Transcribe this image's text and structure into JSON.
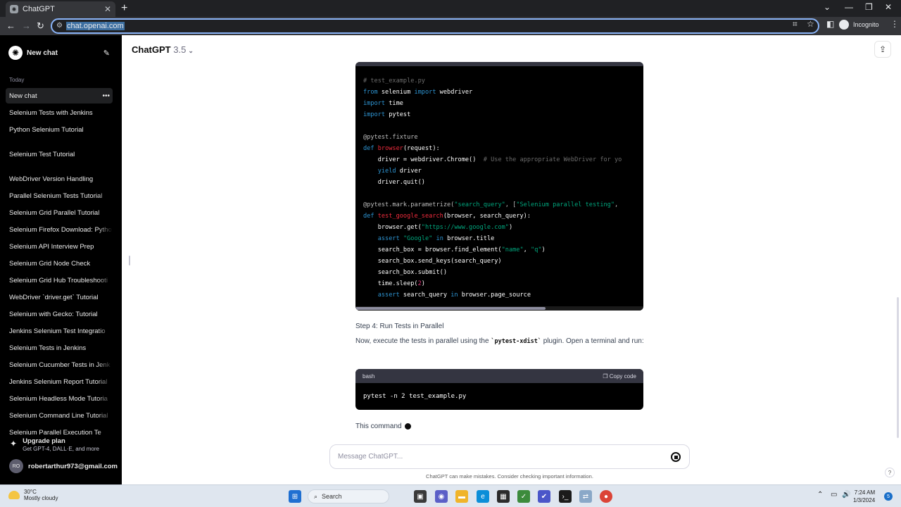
{
  "browser": {
    "tab_title": "ChatGPT",
    "tab_close": "✕",
    "new_tab": "+",
    "url": "chat.openai.com",
    "incognito_label": "Incognito"
  },
  "sidebar": {
    "new_chat_label": "New chat",
    "section_label": "Today",
    "items": [
      {
        "label": "New chat"
      },
      {
        "label": "Selenium Tests with Jenkins"
      },
      {
        "label": "Python Selenium Tutorial"
      },
      {
        "label": "Selenium Test Tutorial"
      },
      {
        "label": "WebDriver Version Handling"
      },
      {
        "label": "Parallel Selenium Tests Tutorial"
      },
      {
        "label": "Selenium Grid Parallel Tutorial"
      },
      {
        "label": "Selenium Firefox Download: Pytho"
      },
      {
        "label": "Selenium API Interview Prep"
      },
      {
        "label": "Selenium Grid Node Check"
      },
      {
        "label": "Selenium Grid Hub Troubleshooti"
      },
      {
        "label": "WebDriver `driver.get` Tutorial"
      },
      {
        "label": "Selenium with Gecko: Tutorial"
      },
      {
        "label": "Jenkins Selenium Test Integratio"
      },
      {
        "label": "Selenium Tests in Jenkins"
      },
      {
        "label": "Selenium Cucumber Tests in Jenk"
      },
      {
        "label": "Jenkins Selenium Report Tutorial"
      },
      {
        "label": "Selenium Headless Mode Tutoria"
      },
      {
        "label": "Selenium Command Line Tutorial"
      },
      {
        "label": "Selenium Parallel Execution Te"
      }
    ],
    "upgrade_title": "Upgrade plan",
    "upgrade_sub": "Get GPT-4, DALL·E, and more",
    "user_initials": "RO",
    "user_email": "robertarthur973@gmail.com"
  },
  "main": {
    "model_name": "ChatGPT",
    "model_version": "3.5",
    "step_heading": "Step 4: Run Tests in Parallel",
    "para_part1": "Now, execute the tests in parallel using the ",
    "para_code": "`pytest-xdist`",
    "para_part2": " plugin. Open a terminal and run:",
    "code2_lang": "bash",
    "code2_copy": "Copy code",
    "code2_cmd": "pytest -n 2 test_example.py",
    "streaming_text": "This command",
    "message_placeholder": "Message ChatGPT...",
    "disclaimer": "ChatGPT can make mistakes. Consider checking important information.",
    "help": "?"
  },
  "code1_lines": [
    [
      {
        "t": "# test_example.py",
        "c": "com"
      }
    ],
    [
      {
        "t": "from",
        "c": "kw"
      },
      {
        "t": " selenium ",
        "c": ""
      },
      {
        "t": "import",
        "c": "kw"
      },
      {
        "t": " webdriver",
        "c": ""
      }
    ],
    [
      {
        "t": "import",
        "c": "kw"
      },
      {
        "t": " time",
        "c": ""
      }
    ],
    [
      {
        "t": "import",
        "c": "kw"
      },
      {
        "t": " pytest",
        "c": ""
      }
    ],
    [
      {
        "t": "",
        "c": ""
      }
    ],
    [
      {
        "t": "@pytest.fixture",
        "c": "dec"
      }
    ],
    [
      {
        "t": "def",
        "c": "kw"
      },
      {
        "t": " ",
        "c": ""
      },
      {
        "t": "browser",
        "c": "fn"
      },
      {
        "t": "(request):",
        "c": ""
      }
    ],
    [
      {
        "t": "    driver = webdriver.Chrome()  ",
        "c": ""
      },
      {
        "t": "# Use the appropriate WebDriver for yo",
        "c": "com"
      }
    ],
    [
      {
        "t": "    ",
        "c": ""
      },
      {
        "t": "yield",
        "c": "kw"
      },
      {
        "t": " driver",
        "c": ""
      }
    ],
    [
      {
        "t": "    driver.quit()",
        "c": ""
      }
    ],
    [
      {
        "t": "",
        "c": ""
      }
    ],
    [
      {
        "t": "@pytest.mark.parametrize(",
        "c": "dec"
      },
      {
        "t": "\"search_query\"",
        "c": "str"
      },
      {
        "t": ", [",
        "c": "dec"
      },
      {
        "t": "\"Selenium parallel testing\"",
        "c": "str"
      },
      {
        "t": ",",
        "c": "dec"
      }
    ],
    [
      {
        "t": "def",
        "c": "kw"
      },
      {
        "t": " ",
        "c": ""
      },
      {
        "t": "test_google_search",
        "c": "fn"
      },
      {
        "t": "(browser, search_query):",
        "c": ""
      }
    ],
    [
      {
        "t": "    browser.get(",
        "c": ""
      },
      {
        "t": "\"https://www.google.com\"",
        "c": "str"
      },
      {
        "t": ")",
        "c": ""
      }
    ],
    [
      {
        "t": "    ",
        "c": ""
      },
      {
        "t": "assert",
        "c": "kw"
      },
      {
        "t": " ",
        "c": ""
      },
      {
        "t": "\"Google\"",
        "c": "str"
      },
      {
        "t": " ",
        "c": ""
      },
      {
        "t": "in",
        "c": "kw"
      },
      {
        "t": " browser.title",
        "c": ""
      }
    ],
    [
      {
        "t": "    search_box = browser.find_element(",
        "c": ""
      },
      {
        "t": "\"name\"",
        "c": "str"
      },
      {
        "t": ", ",
        "c": ""
      },
      {
        "t": "\"q\"",
        "c": "str"
      },
      {
        "t": ")",
        "c": ""
      }
    ],
    [
      {
        "t": "    search_box.send_keys(search_query)",
        "c": ""
      }
    ],
    [
      {
        "t": "    search_box.submit()",
        "c": ""
      }
    ],
    [
      {
        "t": "    time.sleep(",
        "c": ""
      },
      {
        "t": "2",
        "c": "num"
      },
      {
        "t": ")",
        "c": ""
      }
    ],
    [
      {
        "t": "    ",
        "c": ""
      },
      {
        "t": "assert",
        "c": "kw"
      },
      {
        "t": " search_query ",
        "c": ""
      },
      {
        "t": "in",
        "c": "kw"
      },
      {
        "t": " browser.page_source",
        "c": ""
      }
    ]
  ],
  "taskbar": {
    "temperature": "30°C",
    "weather": "Mostly cloudy",
    "search_label": "Search",
    "time": "7:24 AM",
    "date": "1/3/2024",
    "notifications": "5"
  }
}
